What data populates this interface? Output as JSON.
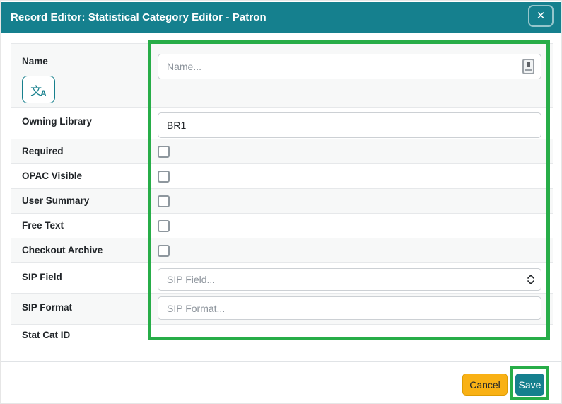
{
  "header": {
    "title": "Record Editor: Statistical Category Editor - Patron",
    "close_glyph": "✕"
  },
  "form": {
    "rows": [
      {
        "label": "Name",
        "control": "text",
        "placeholder": "Name...",
        "value": ""
      },
      {
        "label": "Owning Library",
        "control": "text",
        "placeholder": "",
        "value": "BR1"
      },
      {
        "label": "Required",
        "control": "checkbox",
        "checked": false
      },
      {
        "label": "OPAC Visible",
        "control": "checkbox",
        "checked": false
      },
      {
        "label": "User Summary",
        "control": "checkbox",
        "checked": false
      },
      {
        "label": "Free Text",
        "control": "checkbox",
        "checked": false
      },
      {
        "label": "Checkout Archive",
        "control": "checkbox",
        "checked": false
      },
      {
        "label": "SIP Field",
        "control": "select",
        "placeholder": "SIP Field..."
      },
      {
        "label": "SIP Format",
        "control": "text",
        "placeholder": "SIP Format...",
        "value": ""
      },
      {
        "label": "Stat Cat ID",
        "control": "static",
        "value": ""
      }
    ],
    "translate_icon": {
      "glyph_primary": "文",
      "glyph_secondary": "A"
    }
  },
  "footer": {
    "cancel_label": "Cancel",
    "save_label": "Save"
  },
  "annotations": {
    "highlight_color": "#27AD48",
    "highlighted_regions": [
      "form-controls-column",
      "save-button"
    ]
  },
  "colors": {
    "header_bg": "#15808E",
    "accent_teal": "#17808D",
    "cancel_yellow": "#F9B115",
    "row_stripe": "#F7F8F8",
    "highlight_green": "#27AD48"
  }
}
